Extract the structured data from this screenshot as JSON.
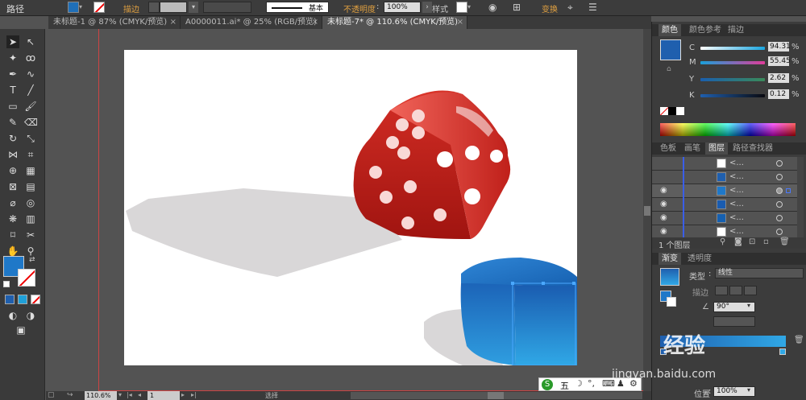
{
  "topbar": {
    "mode_label": "路径",
    "stroke_label": "描边",
    "stroke_style": "基本",
    "opacity_label": "不透明度",
    "opacity_value": "100%",
    "style_label": "样式",
    "transform_label": "变换"
  },
  "tabs": [
    {
      "label": "未标题-1 @ 87% (CMYK/预览)"
    },
    {
      "label": "A0000011.ai* @ 25% (RGB/预览)"
    },
    {
      "label": "未标题-7* @ 110.6% (CMYK/预览)"
    }
  ],
  "color_panel": {
    "tabs": [
      "颜色",
      "颜色参考",
      "描边"
    ],
    "swatch_color": "#1f5fae",
    "channels": [
      {
        "name": "C",
        "value": "94.31"
      },
      {
        "name": "M",
        "value": "55.45"
      },
      {
        "name": "Y",
        "value": "2.62"
      },
      {
        "name": "K",
        "value": "0.12"
      }
    ],
    "unit": "%"
  },
  "layers_panel": {
    "tabs": [
      "色板",
      "画笔",
      "图层",
      "路径查找器"
    ],
    "rows": [
      {
        "name": "<...",
        "visible": false
      },
      {
        "name": "<...",
        "visible": false
      },
      {
        "name": "<...",
        "visible": true
      },
      {
        "name": "<...",
        "visible": true
      },
      {
        "name": "<...",
        "visible": true
      },
      {
        "name": "<...",
        "visible": true
      }
    ],
    "count_label": "1 个图层"
  },
  "gradient_panel": {
    "tabs": [
      "渐变",
      "透明度"
    ],
    "type_label": "类型",
    "type_value": "线性",
    "stroke_label": "描边",
    "angle_value": "90°",
    "location_label": "位置",
    "location_value": "100%"
  },
  "statusbar": {
    "zoom": "110.6%",
    "page": "1",
    "mode": "选择"
  },
  "ime": {
    "label": "五"
  },
  "watermark": {
    "text": "经验",
    "url": "jingyan.baidu.com"
  }
}
